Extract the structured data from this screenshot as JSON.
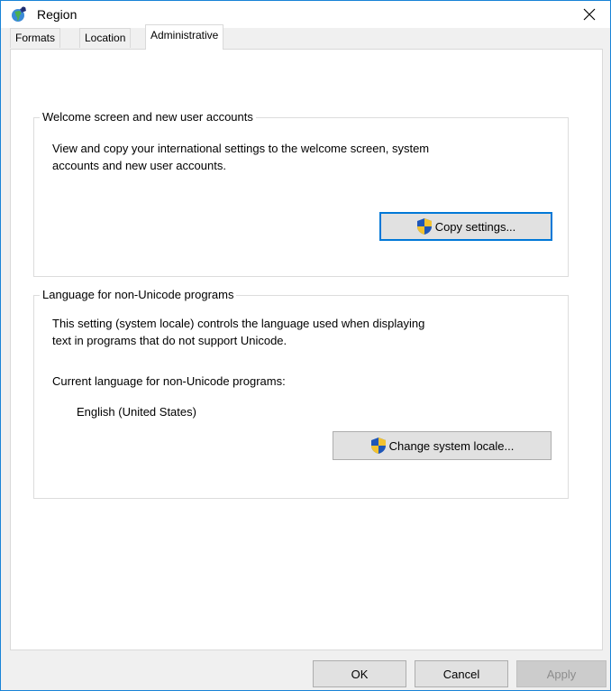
{
  "window": {
    "title": "Region",
    "close_symbol": "✕"
  },
  "tabs": [
    {
      "label": "Formats",
      "active": false
    },
    {
      "label": "Location",
      "active": false
    },
    {
      "label": "Administrative",
      "active": true
    }
  ],
  "welcome_group": {
    "title": "Welcome screen and new user accounts",
    "description_line1": "View and copy your international settings to the welcome screen, system",
    "description_line2": "accounts and new user accounts.",
    "copy_button_label": "Copy settings..."
  },
  "locale_group": {
    "title": "Language for non-Unicode programs",
    "description_line1": "This setting (system locale) controls the language used when displaying",
    "description_line2": "text in programs that do not support Unicode.",
    "current_label": "Current language for non-Unicode programs:",
    "current_value": "English (United States)",
    "change_button_label": "Change system locale..."
  },
  "footer": {
    "ok_label": "OK",
    "cancel_label": "Cancel",
    "apply_label": "Apply"
  },
  "colors": {
    "accent": "#0078d7",
    "panel_bg": "#ffffff",
    "window_bg": "#f0f0f0"
  }
}
